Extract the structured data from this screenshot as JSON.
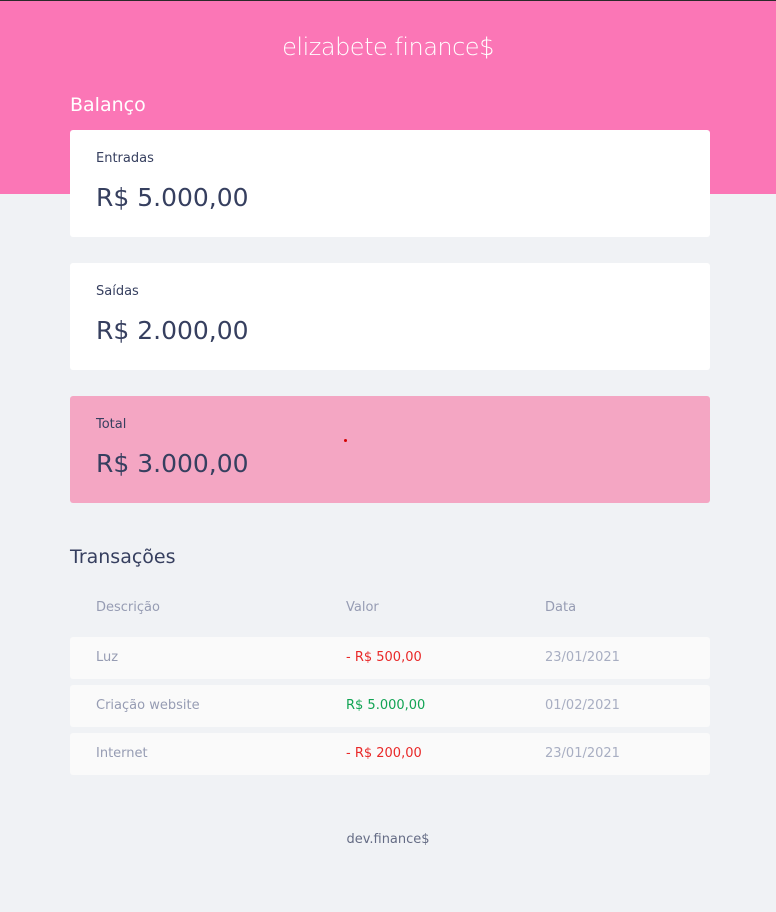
{
  "header": {
    "logo": "elizabete.finance$"
  },
  "balance": {
    "title": "Balanço",
    "income": {
      "label": "Entradas",
      "amount": "R$ 5.000,00"
    },
    "expense": {
      "label": "Saídas",
      "amount": "R$ 2.000,00"
    },
    "total": {
      "label": "Total",
      "amount": "R$ 3.000,00"
    }
  },
  "transactions": {
    "title": "Transações",
    "columns": [
      "Descrição",
      "Valor",
      "Data"
    ],
    "rows": [
      {
        "description": "Luz",
        "value": "- R$ 500,00",
        "date": "23/01/2021",
        "type": "negative"
      },
      {
        "description": "Criação website",
        "value": "R$ 5.000,00",
        "date": "01/02/2021",
        "type": "positive"
      },
      {
        "description": "Internet",
        "value": "- R$ 200,00",
        "date": "23/01/2021",
        "type": "negative"
      }
    ]
  },
  "footer": {
    "text": "dev.finance$"
  },
  "colors": {
    "header": "#fb76b6",
    "total_card": "#f4a6c3",
    "negative": "#e92929",
    "positive": "#12a454",
    "background": "#f0f2f5"
  }
}
